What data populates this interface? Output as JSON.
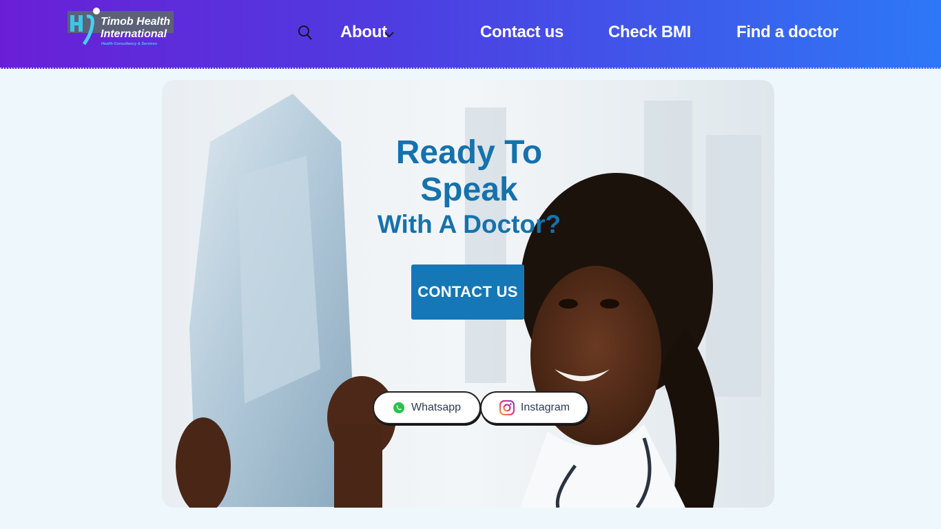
{
  "header": {
    "logo_title_line1": "Timob Health",
    "logo_title_line2": "International",
    "logo_subtitle": "Health Consultancy & Services",
    "nav": [
      {
        "label": "About"
      },
      {
        "label": "Contact us"
      },
      {
        "label": "Check BMI"
      },
      {
        "label": "Find a doctor"
      }
    ],
    "search_icon": "search-icon",
    "dropdown_icon": "chevron-down-icon",
    "gradient_colors": [
      "#6a1fd6",
      "#2d78f6"
    ]
  },
  "hero": {
    "headline_line1": "Ready To",
    "headline_line2": "Speak",
    "headline_line3": "With A Doctor?",
    "cta_label": "CONTACT US",
    "whatsapp_label": "Whatsapp",
    "instagram_label": "Instagram",
    "accent_color": "#1677b6"
  }
}
